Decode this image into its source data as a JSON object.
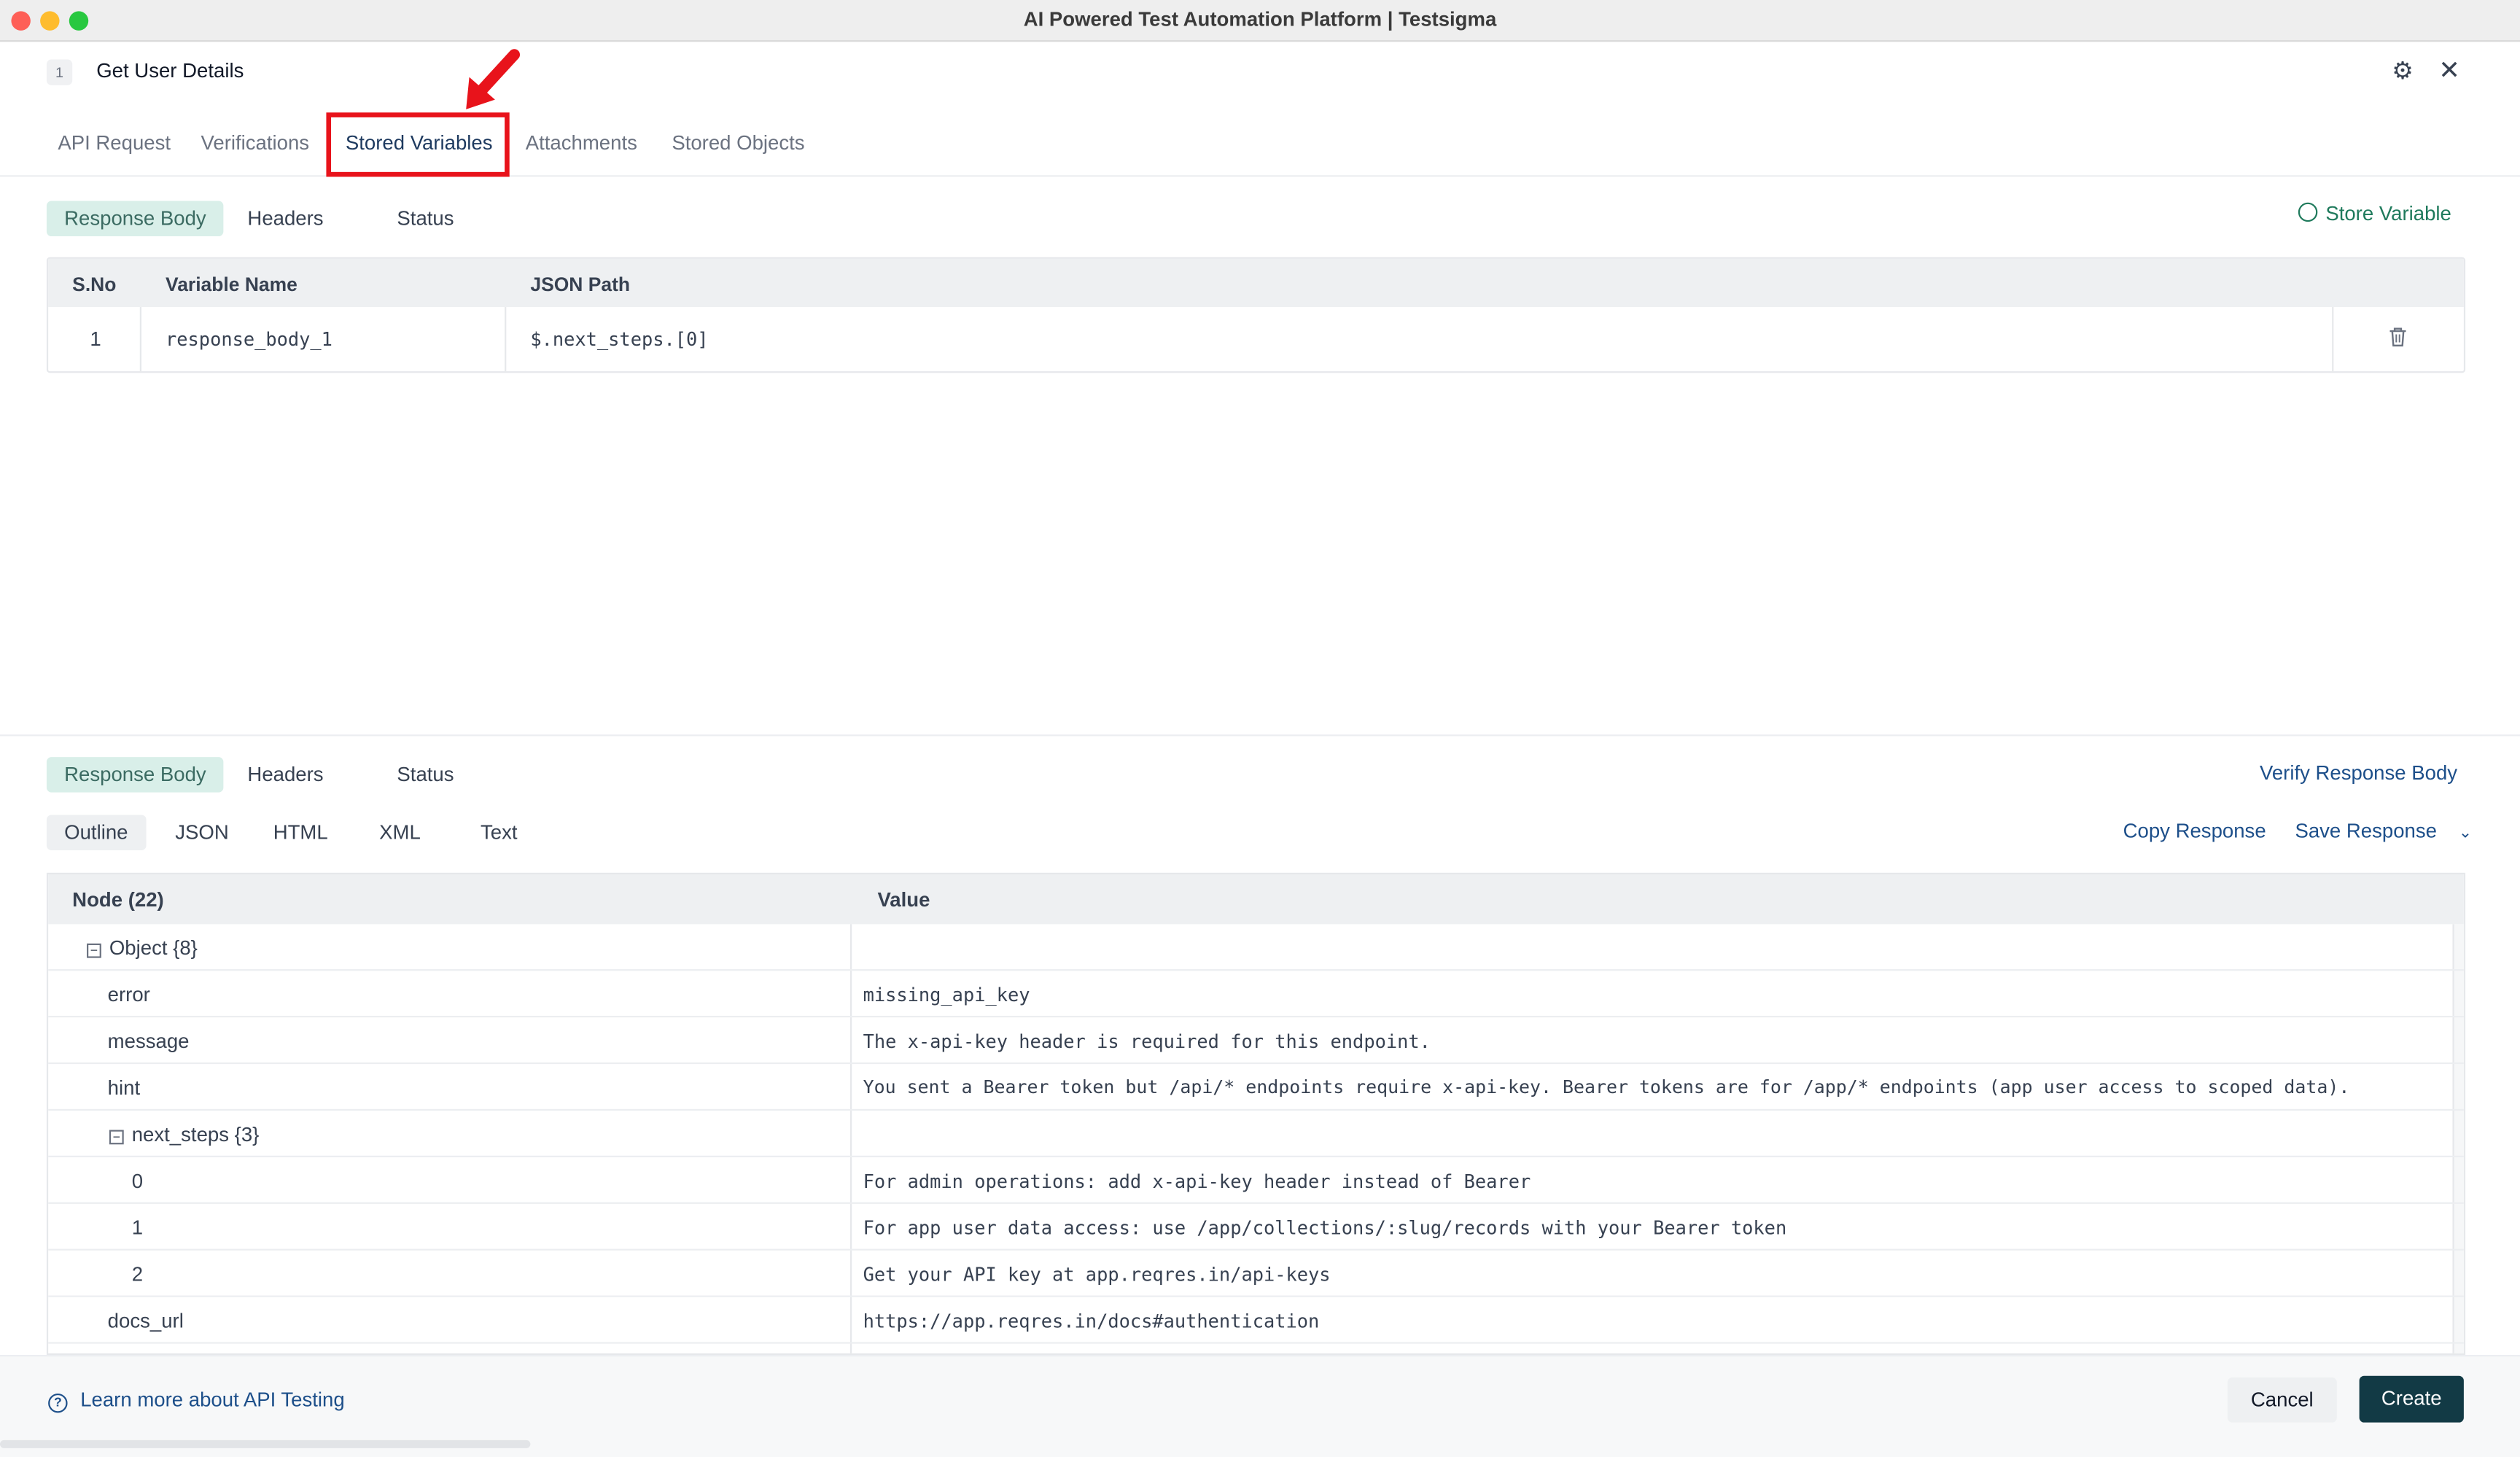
{
  "window": {
    "title": "AI Powered Test Automation Platform | Testsigma"
  },
  "step": {
    "number": "1",
    "title": "Get User Details"
  },
  "tabs": [
    {
      "label": "API Request"
    },
    {
      "label": "Verifications"
    },
    {
      "label": "Stored Variables"
    },
    {
      "label": "Attachments"
    },
    {
      "label": "Stored Objects"
    }
  ],
  "active_tab": "Stored Variables",
  "stored": {
    "subtabs": [
      "Response Body",
      "Headers",
      "Status"
    ],
    "store_variable_label": "Store Variable",
    "columns": [
      "S.No",
      "Variable Name",
      "JSON Path"
    ],
    "rows": [
      {
        "sno": "1",
        "name": "response_body_1",
        "path": "$.next_steps.[0]"
      }
    ]
  },
  "response": {
    "subtabs": [
      "Response Body",
      "Headers",
      "Status"
    ],
    "verify_label": "Verify Response Body",
    "formats": [
      "Outline",
      "JSON",
      "HTML",
      "XML",
      "Text"
    ],
    "copy_label": "Copy Response",
    "save_label": "Save Response",
    "columns": [
      "Node (22)",
      "Value"
    ],
    "nodes": [
      {
        "key": "Object {8}",
        "value": ""
      },
      {
        "key": "error",
        "value": "missing_api_key"
      },
      {
        "key": "message",
        "value": "The x-api-key header is required for this endpoint."
      },
      {
        "key": "hint",
        "value": "You sent a Bearer token but /api/* endpoints require x-api-key. Bearer tokens are for /app/* endpoints (app user access to scoped data)."
      },
      {
        "key": "next_steps {3}",
        "value": ""
      },
      {
        "key": "0",
        "value": "For admin operations: add x-api-key header instead of Bearer"
      },
      {
        "key": "1",
        "value": "For app user data access: use /app/collections/:slug/records with your Bearer token"
      },
      {
        "key": "2",
        "value": "Get your API key at app.reqres.in/api-keys"
      },
      {
        "key": "docs_url",
        "value": "https://app.reqres.in/docs#authentication"
      }
    ]
  },
  "footer": {
    "learn_label": "Learn more about API Testing",
    "cancel_label": "Cancel",
    "create_label": "Create"
  },
  "colors": {
    "accent_green": "#1f7a5c",
    "create_button": "#123a45",
    "highlight_red": "#e8131b"
  },
  "icons": [
    "gear-icon",
    "close-icon",
    "store-variable-icon",
    "trash-icon",
    "collapse-icon",
    "help-icon",
    "chevron-down-icon",
    "annotation-arrow"
  ]
}
